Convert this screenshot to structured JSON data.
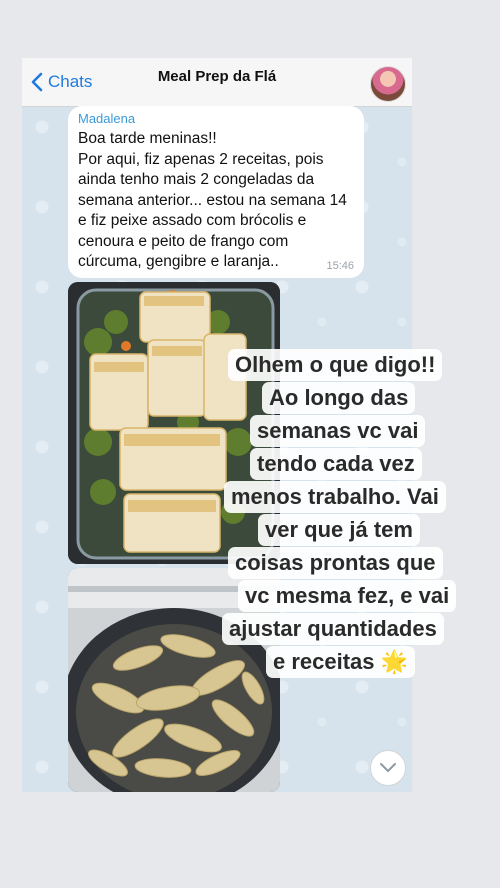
{
  "header": {
    "back_label": "Chats",
    "title": "Meal Prep da Flá"
  },
  "message": {
    "sender": "Madalena",
    "text": "Boa tarde meninas!!\nPor aqui, fiz apenas 2 receitas, pois ainda tenho mais 2 congeladas da semana anterior... estou na semana 14 e fiz peixe assado com brócolis e cenoura e peito de frango com cúrcuma, gengibre e laranja..",
    "time": "15:46"
  },
  "overlay_text": {
    "lines": [
      "Olhem o que digo!!",
      "Ao longo das",
      "semanas vc vai",
      "tendo cada vez",
      "menos trabalho. Vai",
      "ver que já tem",
      "coisas prontas que",
      "vc mesma fez, e vai",
      "ajustar quantidades",
      "e receitas 🌟"
    ]
  },
  "colors": {
    "accent": "#1f7ae0",
    "sender": "#3a9bd8",
    "chat_background": "#d6e3ec"
  },
  "icons": {
    "back": "chevron-left-icon",
    "scroll": "chevron-down-icon"
  }
}
